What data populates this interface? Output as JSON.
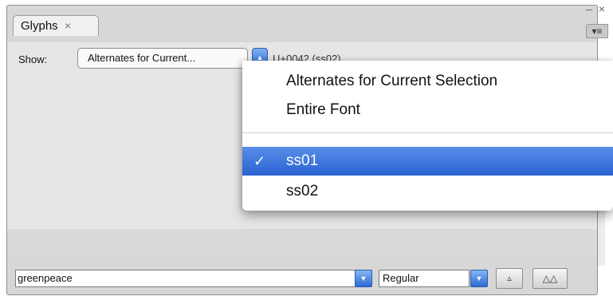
{
  "panel": {
    "tab_label": "Glyphs",
    "tab_close": "×",
    "window_controls": "– ×",
    "menu_icon": "▾≡"
  },
  "toolbar": {
    "show_label": "Show:",
    "show_value": "Alternates for Current...",
    "codepoint": "U+0042 (ss02)"
  },
  "dropdown": {
    "items": [
      {
        "label": "Alternates for Current Selection",
        "selected": false
      },
      {
        "label": "Entire Font",
        "selected": false
      },
      {
        "label": "ss01",
        "selected": true
      },
      {
        "label": "ss02",
        "selected": false
      }
    ],
    "check_mark": "✓"
  },
  "bottom": {
    "font_name": "greenpeace",
    "font_style": "Regular",
    "arrow_glyph": "▼",
    "zoom_out_glyph": "▵",
    "zoom_in_glyph": "△△"
  }
}
